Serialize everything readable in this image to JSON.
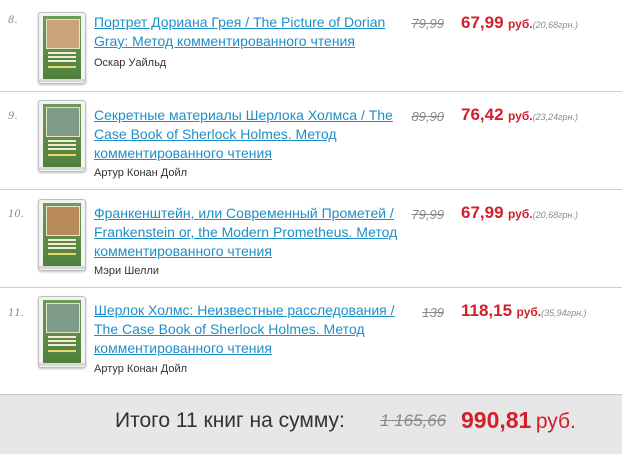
{
  "items": [
    {
      "num": "8.",
      "title": "Портрет Дориана Грея / The Picture of Dorian Gray: Метод комментированного чтения",
      "author": "Оскар Уайльд",
      "old_price": "79,99",
      "price": "67,99",
      "currency": "руб.",
      "price_uah": "(20,68грн.)",
      "cover_color": "#5f8f4a",
      "cover_art": "#c9a37a"
    },
    {
      "num": "9.",
      "title": "Секретные материалы Шерлока Холмса / The Case Book of Sherlock Holmes. Метод комментированного чтения",
      "author": "Артур Конан Дойл",
      "old_price": "89,90",
      "price": "76,42",
      "currency": "руб.",
      "price_uah": "(23,24грн.)",
      "cover_color": "#5f8f4a",
      "cover_art": "#7f9c8a"
    },
    {
      "num": "10.",
      "title": "Франкенштейн, или Современный Прометей / Frankenstein or, the Modern Prometheus. Метод комментированного чтения",
      "author": "Мэри Шелли",
      "old_price": "79,99",
      "price": "67,99",
      "currency": "руб.",
      "price_uah": "(20,68грн.)",
      "cover_color": "#5f8f4a",
      "cover_art": "#b98b5a"
    },
    {
      "num": "11.",
      "title": "Шерлок Холмс: Неизвестные расследования / The Case Book of Sherlock Holmes. Метод комментированного чтения",
      "author": "Артур Конан Дойл",
      "old_price": "139",
      "price": "118,15",
      "currency": "руб.",
      "price_uah": "(35,94грн.)",
      "cover_color": "#5f8f4a",
      "cover_art": "#7f9c8a"
    }
  ],
  "total": {
    "label": "Итого 11 книг на сумму:",
    "old": "1 165,66",
    "new": "990,81",
    "currency": "руб."
  },
  "colors": {
    "link": "#1f8fc7",
    "price": "#d11f2b",
    "muted": "#8a8a8a",
    "total_bg": "#e7e7e7"
  }
}
